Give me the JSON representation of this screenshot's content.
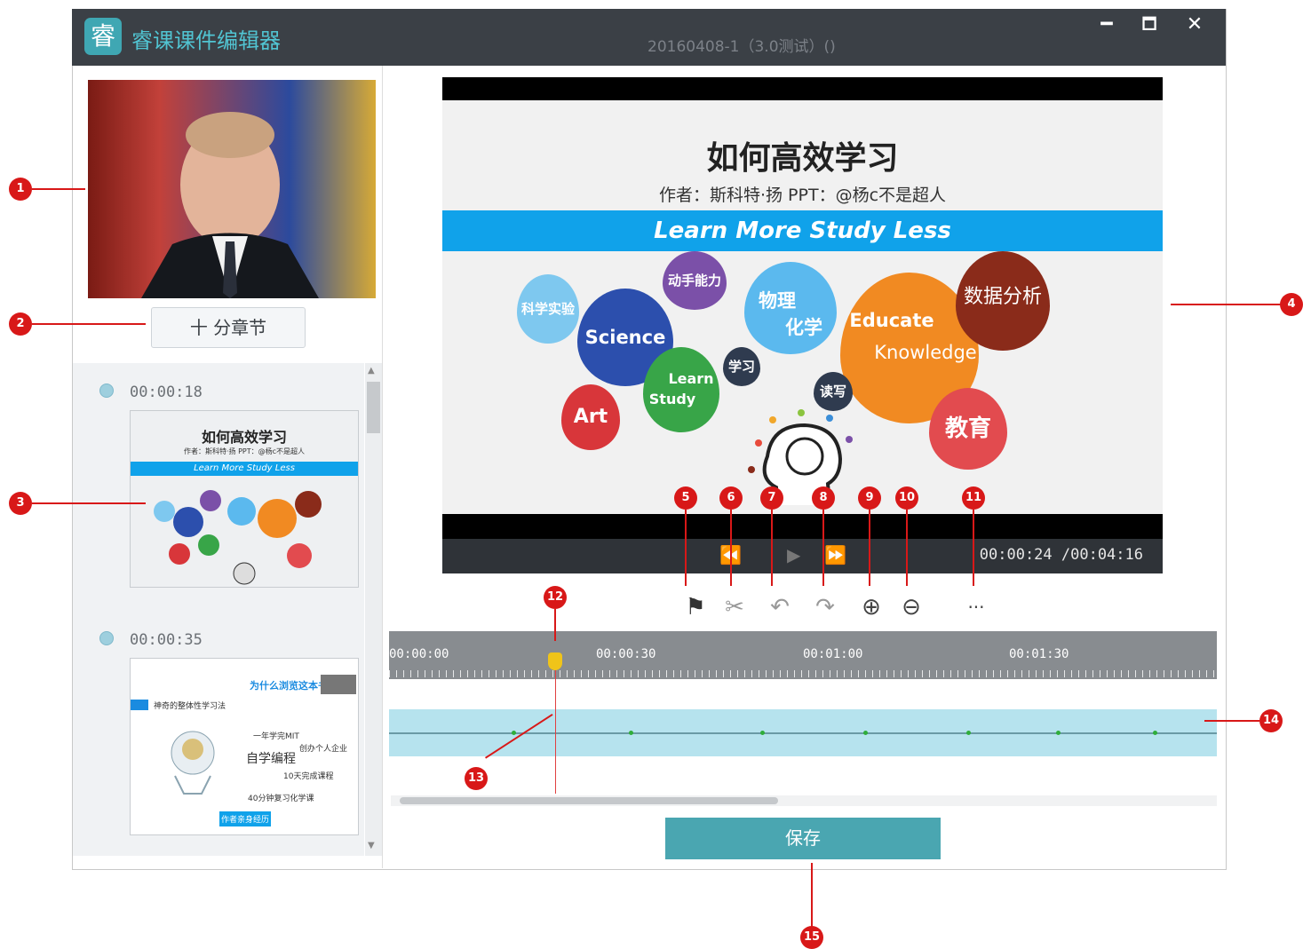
{
  "window": {
    "app_title": "睿课课件编辑器",
    "doc_title": "20160408-1（3.0测试）()",
    "logo_glyph": "睿",
    "minimize": "━",
    "maximize": "🗖",
    "close": "✕"
  },
  "left": {
    "chapter_button": "十 分章节",
    "chapters": [
      {
        "time": "00:00:18",
        "thumb_title": "如何高效学习",
        "thumb_sub": "作者：斯科特·扬 PPT：@杨c不是超人",
        "thumb_band": "Learn More  Study Less"
      },
      {
        "time": "00:00:35",
        "thumb_title": "为什么浏览这本书",
        "thumb_lines": [
          "神奇的整体性学习法",
          "一年学完MIT",
          "创办个人企业",
          "自学编程",
          "10天完成课程",
          "40分钟复习化学课",
          "作者亲身经历"
        ]
      }
    ]
  },
  "slide": {
    "title": "如何高效学习",
    "subtitle": "作者：斯科特·扬    PPT：@杨c不是超人",
    "band": "Learn More  Study Less",
    "bubbles": [
      "科学实验",
      "动手能力",
      "物理",
      "化学",
      "Science",
      "Educate",
      "Knowledge",
      "数据分析",
      "学习",
      "Learn",
      "Study",
      "Art",
      "读写",
      "教育"
    ],
    "bubble_colors": [
      "#7ec8ef",
      "#7b50a8",
      "#5bb9ee",
      "#2c4fad",
      "#f18a22",
      "#8a2b1a",
      "#2f3b4f",
      "#38a548",
      "#d8363a",
      "#e24b4f"
    ]
  },
  "player": {
    "time": "00:00:24 /00:04:16",
    "rewind": "⏪",
    "play": "▶",
    "forward": "⏩"
  },
  "toolbar": {
    "flag_icon": "⚑",
    "cut_icon": "✂",
    "undo_icon": "↶",
    "redo_icon": "↷",
    "zoom_in_icon": "⊕",
    "zoom_out_icon": "⊖",
    "more_icon": "···"
  },
  "timeline": {
    "ticks": [
      "00:00:00",
      "00:00:30",
      "00:01:00",
      "00:01:30"
    ]
  },
  "save_button": "保存",
  "annotations": [
    "1",
    "2",
    "3",
    "4",
    "5",
    "6",
    "7",
    "8",
    "9",
    "10",
    "11",
    "12",
    "13",
    "14",
    "15"
  ]
}
